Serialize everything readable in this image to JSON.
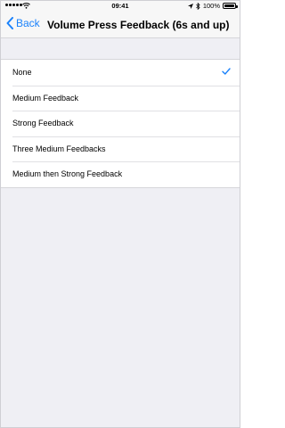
{
  "status_bar": {
    "time": "09:41",
    "battery": "100%",
    "battery_level": 1.0,
    "icons": [
      "signal-icon",
      "wifi-icon",
      "location-icon",
      "bluetooth-icon",
      "battery-icon"
    ]
  },
  "nav": {
    "back_label": "Back",
    "title": "Volume Press Feedback (6s and up)"
  },
  "options": [
    {
      "label": "None",
      "selected": true
    },
    {
      "label": "Medium Feedback",
      "selected": false
    },
    {
      "label": "Strong Feedback",
      "selected": false
    },
    {
      "label": "Three Medium Feedbacks",
      "selected": false
    },
    {
      "label": "Medium then Strong Feedback",
      "selected": false
    }
  ],
  "colors": {
    "accent": "#1a82fb",
    "background": "#efeff4",
    "bar": "#f7f7f7"
  }
}
